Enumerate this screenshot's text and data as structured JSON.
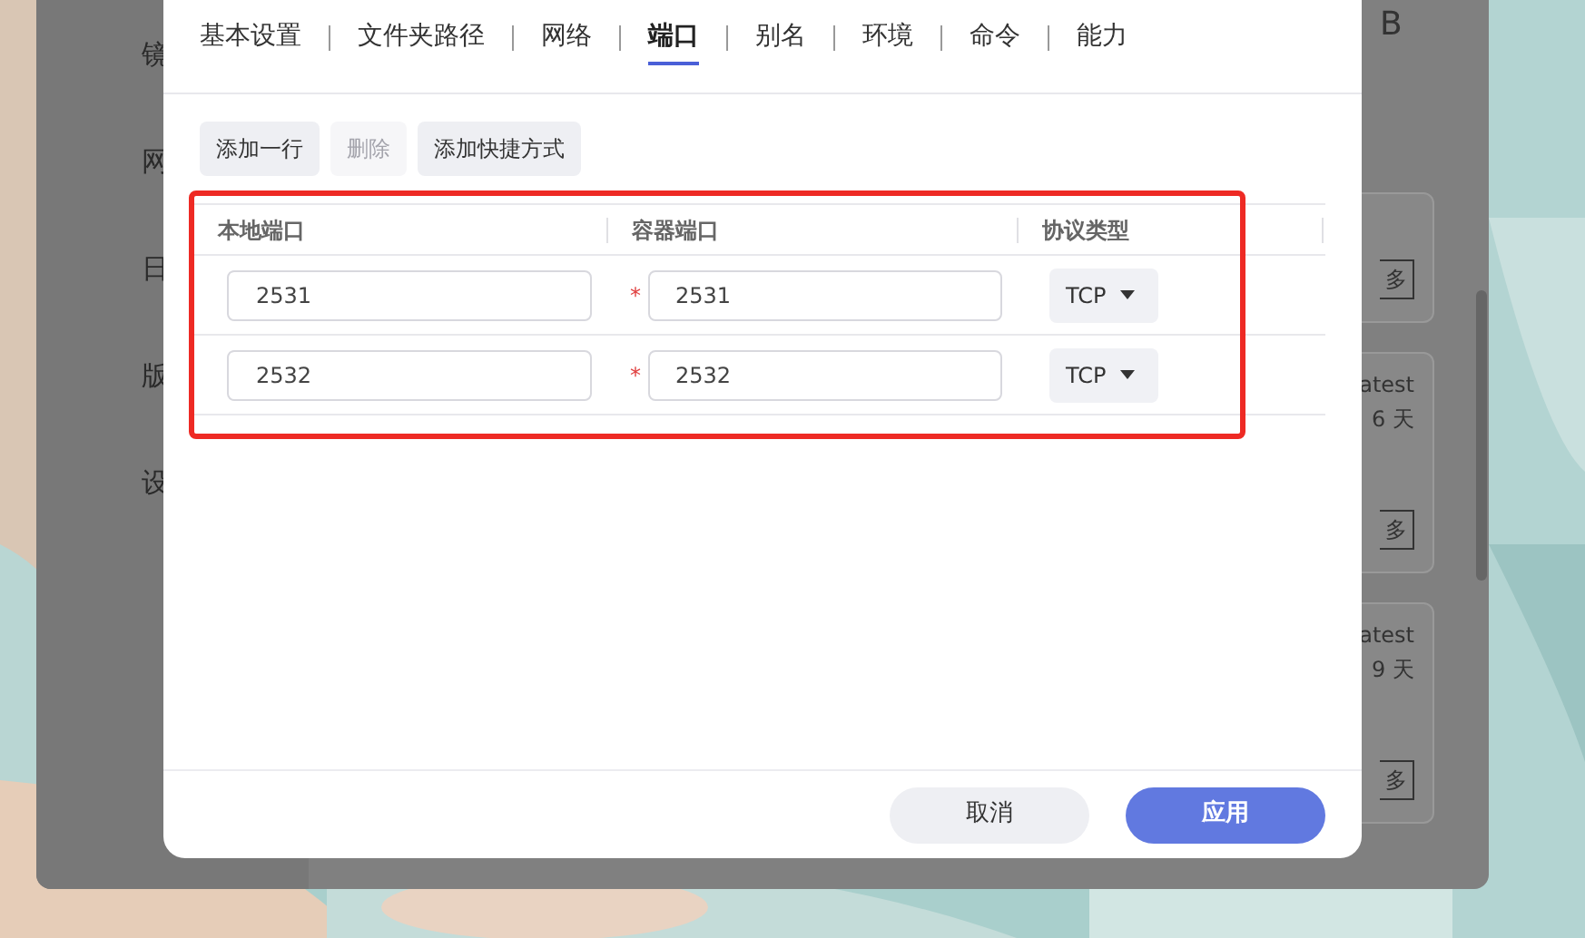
{
  "background_window": {
    "sidebar_items": [
      "镜",
      "网",
      "日",
      "版",
      "设"
    ],
    "header_fragment": "B",
    "cards": [
      {
        "button": "多"
      },
      {
        "lines": [
          "atest",
          "6 天"
        ],
        "button": "多"
      },
      {
        "lines": [
          "atest",
          "9 天"
        ],
        "button": "多"
      }
    ]
  },
  "tabs": [
    {
      "label": "基本设置",
      "selected": false
    },
    {
      "label": "文件夹路径",
      "selected": false
    },
    {
      "label": "网络",
      "selected": false
    },
    {
      "label": "端口",
      "selected": true
    },
    {
      "label": "别名",
      "selected": false
    },
    {
      "label": "环境",
      "selected": false
    },
    {
      "label": "命令",
      "selected": false
    },
    {
      "label": "能力",
      "selected": false
    }
  ],
  "toolbar": [
    {
      "label": "添加一行",
      "disabled": false
    },
    {
      "label": "删除",
      "disabled": true
    },
    {
      "label": "添加快捷方式",
      "disabled": false
    }
  ],
  "table": {
    "columns": [
      "本地端口",
      "容器端口",
      "协议类型"
    ],
    "rows": [
      {
        "local_port": "2531",
        "container_port": "2531",
        "required_mark": "*",
        "protocol": "TCP"
      },
      {
        "local_port": "2532",
        "container_port": "2532",
        "required_mark": "*",
        "protocol": "TCP"
      }
    ]
  },
  "footer_buttons": [
    {
      "label": "取消",
      "kind": "secondary"
    },
    {
      "label": "应用",
      "kind": "primary"
    }
  ]
}
